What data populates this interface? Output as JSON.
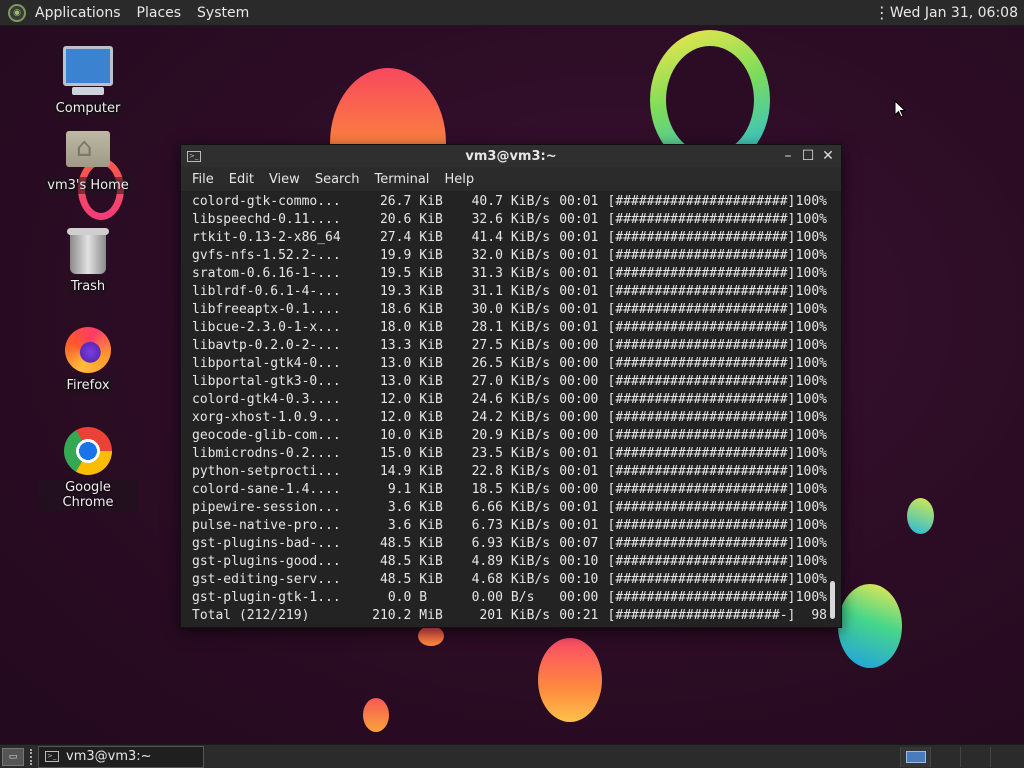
{
  "top_panel": {
    "menu": [
      "Applications",
      "Places",
      "System"
    ],
    "clock": "Wed Jan 31, 06:08"
  },
  "desktop_icons": [
    {
      "label": "Computer",
      "icon": "computer-icon"
    },
    {
      "label": "vm3's Home",
      "icon": "home-folder-icon"
    },
    {
      "label": "Trash",
      "icon": "trash-icon"
    },
    {
      "label": "Firefox",
      "icon": "firefox-icon"
    },
    {
      "label": "Google Chrome",
      "icon": "chrome-icon"
    }
  ],
  "terminal": {
    "title": "vm3@vm3:~",
    "menu": [
      "File",
      "Edit",
      "View",
      "Search",
      "Terminal",
      "Help"
    ],
    "rows": [
      {
        "name": "colord-gtk-commo...",
        "size": "26.7",
        "unit": "KiB",
        "rate": "40.7",
        "runit": "KiB/s",
        "time": "00:01",
        "bar": "[######################]",
        "pct": "100%"
      },
      {
        "name": "libspeechd-0.11....",
        "size": "20.6",
        "unit": "KiB",
        "rate": "32.6",
        "runit": "KiB/s",
        "time": "00:01",
        "bar": "[######################]",
        "pct": "100%"
      },
      {
        "name": "rtkit-0.13-2-x86_64",
        "size": "27.4",
        "unit": "KiB",
        "rate": "41.4",
        "runit": "KiB/s",
        "time": "00:01",
        "bar": "[######################]",
        "pct": "100%"
      },
      {
        "name": "gvfs-nfs-1.52.2-...",
        "size": "19.9",
        "unit": "KiB",
        "rate": "32.0",
        "runit": "KiB/s",
        "time": "00:01",
        "bar": "[######################]",
        "pct": "100%"
      },
      {
        "name": "sratom-0.6.16-1-...",
        "size": "19.5",
        "unit": "KiB",
        "rate": "31.3",
        "runit": "KiB/s",
        "time": "00:01",
        "bar": "[######################]",
        "pct": "100%"
      },
      {
        "name": "liblrdf-0.6.1-4-...",
        "size": "19.3",
        "unit": "KiB",
        "rate": "31.1",
        "runit": "KiB/s",
        "time": "00:01",
        "bar": "[######################]",
        "pct": "100%"
      },
      {
        "name": "libfreeaptx-0.1....",
        "size": "18.6",
        "unit": "KiB",
        "rate": "30.0",
        "runit": "KiB/s",
        "time": "00:01",
        "bar": "[######################]",
        "pct": "100%"
      },
      {
        "name": "libcue-2.3.0-1-x...",
        "size": "18.0",
        "unit": "KiB",
        "rate": "28.1",
        "runit": "KiB/s",
        "time": "00:01",
        "bar": "[######################]",
        "pct": "100%"
      },
      {
        "name": "libavtp-0.2.0-2-...",
        "size": "13.3",
        "unit": "KiB",
        "rate": "27.5",
        "runit": "KiB/s",
        "time": "00:00",
        "bar": "[######################]",
        "pct": "100%"
      },
      {
        "name": "libportal-gtk4-0...",
        "size": "13.0",
        "unit": "KiB",
        "rate": "26.5",
        "runit": "KiB/s",
        "time": "00:00",
        "bar": "[######################]",
        "pct": "100%"
      },
      {
        "name": "libportal-gtk3-0...",
        "size": "13.0",
        "unit": "KiB",
        "rate": "27.0",
        "runit": "KiB/s",
        "time": "00:00",
        "bar": "[######################]",
        "pct": "100%"
      },
      {
        "name": "colord-gtk4-0.3....",
        "size": "12.0",
        "unit": "KiB",
        "rate": "24.6",
        "runit": "KiB/s",
        "time": "00:00",
        "bar": "[######################]",
        "pct": "100%"
      },
      {
        "name": "xorg-xhost-1.0.9...",
        "size": "12.0",
        "unit": "KiB",
        "rate": "24.2",
        "runit": "KiB/s",
        "time": "00:00",
        "bar": "[######################]",
        "pct": "100%"
      },
      {
        "name": "geocode-glib-com...",
        "size": "10.0",
        "unit": "KiB",
        "rate": "20.9",
        "runit": "KiB/s",
        "time": "00:00",
        "bar": "[######################]",
        "pct": "100%"
      },
      {
        "name": "libmicrodns-0.2....",
        "size": "15.0",
        "unit": "KiB",
        "rate": "23.5",
        "runit": "KiB/s",
        "time": "00:01",
        "bar": "[######################]",
        "pct": "100%"
      },
      {
        "name": "python-setprocti...",
        "size": "14.9",
        "unit": "KiB",
        "rate": "22.8",
        "runit": "KiB/s",
        "time": "00:01",
        "bar": "[######################]",
        "pct": "100%"
      },
      {
        "name": "colord-sane-1.4....",
        "size": "9.1",
        "unit": "KiB",
        "rate": "18.5",
        "runit": "KiB/s",
        "time": "00:00",
        "bar": "[######################]",
        "pct": "100%"
      },
      {
        "name": "pipewire-session...",
        "size": "3.6",
        "unit": "KiB",
        "rate": "6.66",
        "runit": "KiB/s",
        "time": "00:01",
        "bar": "[######################]",
        "pct": "100%"
      },
      {
        "name": "pulse-native-pro...",
        "size": "3.6",
        "unit": "KiB",
        "rate": "6.73",
        "runit": "KiB/s",
        "time": "00:01",
        "bar": "[######################]",
        "pct": "100%"
      },
      {
        "name": "gst-plugins-bad-...",
        "size": "48.5",
        "unit": "KiB",
        "rate": "6.93",
        "runit": "KiB/s",
        "time": "00:07",
        "bar": "[######################]",
        "pct": "100%"
      },
      {
        "name": "gst-plugins-good...",
        "size": "48.5",
        "unit": "KiB",
        "rate": "4.89",
        "runit": "KiB/s",
        "time": "00:10",
        "bar": "[######################]",
        "pct": "100%"
      },
      {
        "name": "gst-editing-serv...",
        "size": "48.5",
        "unit": "KiB",
        "rate": "4.68",
        "runit": "KiB/s",
        "time": "00:10",
        "bar": "[######################]",
        "pct": "100%"
      },
      {
        "name": "gst-plugin-gtk-1...",
        "size": "0.0",
        "unit": "B",
        "rate": "0.00",
        "runit": "B/s",
        "time": "00:00",
        "bar": "[######################]",
        "pct": "100%"
      },
      {
        "name": "Total (212/219)",
        "size": "210.2",
        "unit": "MiB",
        "rate": "201",
        "runit": "KiB/s",
        "time": "00:21",
        "bar": "[#####################-]",
        "pct": "98"
      }
    ]
  },
  "taskbar": {
    "show_desktop_label": "▭",
    "task_label": "vm3@vm3:~"
  },
  "colors": {
    "desktop_bg": "#2b0c24",
    "panel_bg": "#2a2a2a",
    "terminal_bg": "#232323"
  }
}
